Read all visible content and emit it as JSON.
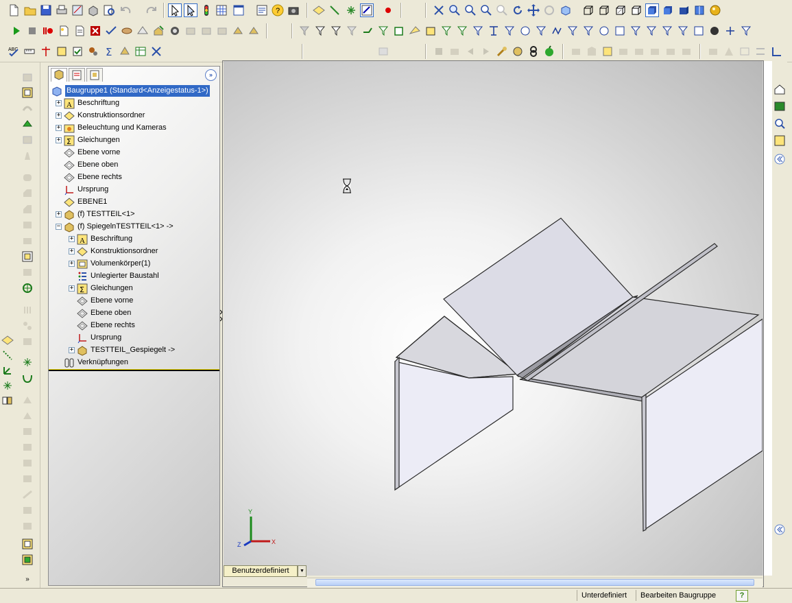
{
  "feature_manager": {
    "root": "Baugruppe1  (Standard<Anzeigestatus-1>)",
    "items": [
      {
        "label": "Beschriftung",
        "icon": "annotation-icon",
        "expandable": true,
        "level": 0
      },
      {
        "label": "Konstruktionsordner",
        "icon": "design-folder-icon",
        "expandable": true,
        "level": 0
      },
      {
        "label": "Beleuchtung und Kameras",
        "icon": "lights-cameras-icon",
        "expandable": true,
        "level": 0
      },
      {
        "label": "Gleichungen",
        "icon": "equations-icon",
        "expandable": true,
        "level": 0
      },
      {
        "label": "Ebene vorne",
        "icon": "plane-icon",
        "expandable": false,
        "level": 0
      },
      {
        "label": "Ebene oben",
        "icon": "plane-icon",
        "expandable": false,
        "level": 0
      },
      {
        "label": "Ebene rechts",
        "icon": "plane-icon",
        "expandable": false,
        "level": 0
      },
      {
        "label": "Ursprung",
        "icon": "origin-icon",
        "expandable": false,
        "level": 0
      },
      {
        "label": "EBENE1",
        "icon": "plane-yellow-icon",
        "expandable": false,
        "level": 0
      },
      {
        "label": "(f) TESTTEIL<1>",
        "icon": "part-icon",
        "expandable": true,
        "level": 0
      },
      {
        "label": "(f) SpiegelnTESTTEIL<1> ->",
        "icon": "part-icon",
        "expandable": true,
        "expanded": true,
        "level": 0
      },
      {
        "label": "Beschriftung",
        "icon": "annotation-icon",
        "expandable": true,
        "level": 1
      },
      {
        "label": "Konstruktionsordner",
        "icon": "design-folder-icon",
        "expandable": true,
        "level": 1
      },
      {
        "label": "Volumenkörper(1)",
        "icon": "solid-bodies-icon",
        "expandable": true,
        "level": 1
      },
      {
        "label": "Unlegierter Baustahl",
        "icon": "material-icon",
        "expandable": false,
        "level": 1
      },
      {
        "label": "Gleichungen",
        "icon": "equations-icon",
        "expandable": true,
        "level": 1
      },
      {
        "label": "Ebene vorne",
        "icon": "plane-icon",
        "expandable": false,
        "level": 1
      },
      {
        "label": "Ebene oben",
        "icon": "plane-icon",
        "expandable": false,
        "level": 1
      },
      {
        "label": "Ebene rechts",
        "icon": "plane-icon",
        "expandable": false,
        "level": 1
      },
      {
        "label": "Ursprung",
        "icon": "origin-icon",
        "expandable": false,
        "level": 1
      },
      {
        "label": "TESTTEIL_Gespiegelt ->",
        "icon": "part-icon",
        "expandable": true,
        "level": 1
      },
      {
        "label": "Verknüpfungen",
        "icon": "mates-icon",
        "expandable": false,
        "level": 0
      }
    ],
    "expand_glyph": "+",
    "collapse_glyph": "−"
  },
  "graphics": {
    "view_tab": "Benutzerdefiniert",
    "triad": {
      "x_label": "X",
      "y_label": "Y",
      "z_label": "Z"
    }
  },
  "statusbar": {
    "state": "Unterdefiniert",
    "mode": "Bearbeiten Baugruppe",
    "help": "?"
  },
  "colors": {
    "selection": "#3169c6",
    "part_face": "#e4e4ee",
    "part_edge": "#2a2a2a",
    "panel_bg": "#ece9d8"
  }
}
